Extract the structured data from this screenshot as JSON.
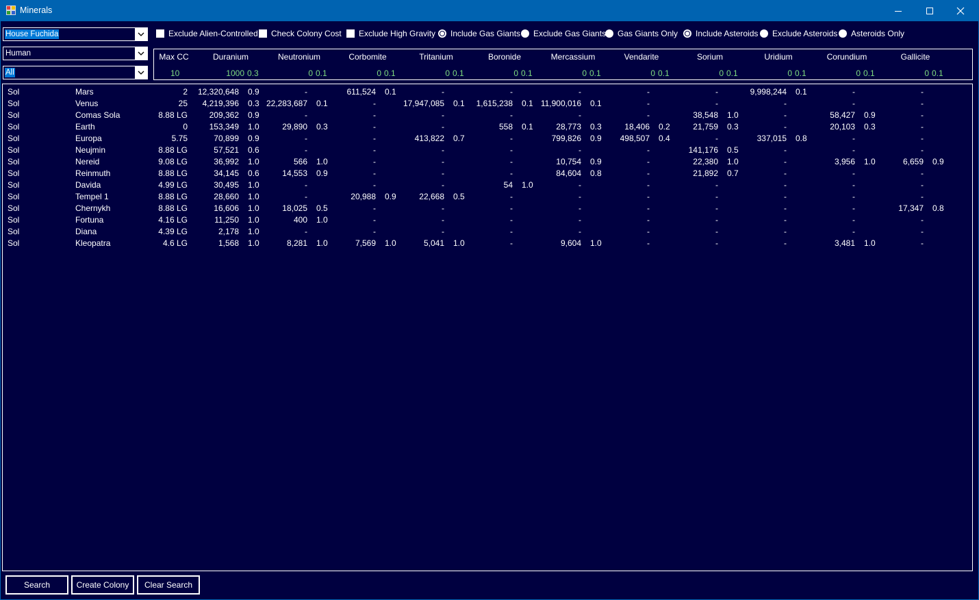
{
  "window": {
    "title": "Minerals"
  },
  "filters": {
    "race": "House Fuchida",
    "species": "Human",
    "system": "All"
  },
  "options": [
    {
      "label": "Exclude Alien-Controlled",
      "type": "checkbox",
      "checked": false
    },
    {
      "label": "Check Colony Cost",
      "type": "checkbox",
      "checked": false
    },
    {
      "label": "Exclude High Gravity",
      "type": "checkbox",
      "checked": false
    },
    {
      "label": "Include Gas Giants",
      "type": "radio",
      "checked": true
    },
    {
      "label": "Exclude Gas Giants",
      "type": "radio",
      "checked": false
    },
    {
      "label": "Gas Giants Only",
      "type": "radio",
      "checked": false
    },
    {
      "label": "Include Asteroids",
      "type": "radio",
      "checked": true
    },
    {
      "label": "Exclude Asteroids",
      "type": "radio",
      "checked": false
    },
    {
      "label": "Asteroids Only",
      "type": "radio",
      "checked": false
    }
  ],
  "header": {
    "max_cc": {
      "label": "Max CC",
      "value": "10"
    },
    "minerals": [
      {
        "name": "Duranium",
        "amount": "1000",
        "access": "0.3"
      },
      {
        "name": "Neutronium",
        "amount": "0",
        "access": "0.1"
      },
      {
        "name": "Corbomite",
        "amount": "0",
        "access": "0.1"
      },
      {
        "name": "Tritanium",
        "amount": "0",
        "access": "0.1"
      },
      {
        "name": "Boronide",
        "amount": "0",
        "access": "0.1"
      },
      {
        "name": "Mercassium",
        "amount": "0",
        "access": "0.1"
      },
      {
        "name": "Vendarite",
        "amount": "0",
        "access": "0.1"
      },
      {
        "name": "Sorium",
        "amount": "0",
        "access": "0.1"
      },
      {
        "name": "Uridium",
        "amount": "0",
        "access": "0.1"
      },
      {
        "name": "Corundium",
        "amount": "0",
        "access": "0.1"
      },
      {
        "name": "Gallicite",
        "amount": "0",
        "access": "0.1"
      }
    ]
  },
  "rows": [
    {
      "system": "Sol",
      "body": "Mars",
      "cc": "2",
      "m": [
        [
          "12,320,648",
          "0.9"
        ],
        [
          "-",
          ""
        ],
        [
          "611,524",
          "0.1"
        ],
        [
          "-",
          ""
        ],
        [
          "-",
          ""
        ],
        [
          "-",
          ""
        ],
        [
          "-",
          ""
        ],
        [
          "-",
          ""
        ],
        [
          "9,998,244",
          "0.1"
        ],
        [
          "-",
          ""
        ],
        [
          "-",
          ""
        ]
      ]
    },
    {
      "system": "Sol",
      "body": "Venus",
      "cc": "25",
      "m": [
        [
          "4,219,396",
          "0.3"
        ],
        [
          "22,283,687",
          "0.1"
        ],
        [
          "-",
          ""
        ],
        [
          "17,947,085",
          "0.1"
        ],
        [
          "1,615,238",
          "0.1"
        ],
        [
          "11,900,016",
          "0.1"
        ],
        [
          "-",
          ""
        ],
        [
          "-",
          ""
        ],
        [
          "-",
          ""
        ],
        [
          "-",
          ""
        ],
        [
          "-",
          ""
        ]
      ]
    },
    {
      "system": "Sol",
      "body": "Comas Sola",
      "cc": "8.88 LG",
      "m": [
        [
          "209,362",
          "0.9"
        ],
        [
          "-",
          ""
        ],
        [
          "-",
          ""
        ],
        [
          "-",
          ""
        ],
        [
          "-",
          ""
        ],
        [
          "-",
          ""
        ],
        [
          "-",
          ""
        ],
        [
          "38,548",
          "1.0"
        ],
        [
          "-",
          ""
        ],
        [
          "58,427",
          "0.9"
        ],
        [
          "-",
          ""
        ]
      ]
    },
    {
      "system": "Sol",
      "body": "Earth",
      "cc": "0",
      "m": [
        [
          "153,349",
          "1.0"
        ],
        [
          "29,890",
          "0.3"
        ],
        [
          "-",
          ""
        ],
        [
          "-",
          ""
        ],
        [
          "558",
          "0.1"
        ],
        [
          "28,773",
          "0.3"
        ],
        [
          "18,406",
          "0.2"
        ],
        [
          "21,759",
          "0.3"
        ],
        [
          "-",
          ""
        ],
        [
          "20,103",
          "0.3"
        ],
        [
          "-",
          ""
        ]
      ]
    },
    {
      "system": "Sol",
      "body": "Europa",
      "cc": "5.75",
      "m": [
        [
          "70,899",
          "0.9"
        ],
        [
          "-",
          ""
        ],
        [
          "-",
          ""
        ],
        [
          "413,822",
          "0.7"
        ],
        [
          "-",
          ""
        ],
        [
          "799,826",
          "0.9"
        ],
        [
          "498,507",
          "0.4"
        ],
        [
          "-",
          ""
        ],
        [
          "337,015",
          "0.8"
        ],
        [
          "-",
          ""
        ],
        [
          "-",
          ""
        ]
      ]
    },
    {
      "system": "Sol",
      "body": "Neujmin",
      "cc": "8.88 LG",
      "m": [
        [
          "57,521",
          "0.6"
        ],
        [
          "-",
          ""
        ],
        [
          "-",
          ""
        ],
        [
          "-",
          ""
        ],
        [
          "-",
          ""
        ],
        [
          "-",
          ""
        ],
        [
          "-",
          ""
        ],
        [
          "141,176",
          "0.5"
        ],
        [
          "-",
          ""
        ],
        [
          "-",
          ""
        ],
        [
          "-",
          ""
        ]
      ]
    },
    {
      "system": "Sol",
      "body": "Nereid",
      "cc": "9.08 LG",
      "m": [
        [
          "36,992",
          "1.0"
        ],
        [
          "566",
          "1.0"
        ],
        [
          "-",
          ""
        ],
        [
          "-",
          ""
        ],
        [
          "-",
          ""
        ],
        [
          "10,754",
          "0.9"
        ],
        [
          "-",
          ""
        ],
        [
          "22,380",
          "1.0"
        ],
        [
          "-",
          ""
        ],
        [
          "3,956",
          "1.0"
        ],
        [
          "6,659",
          "0.9"
        ]
      ]
    },
    {
      "system": "Sol",
      "body": "Reinmuth",
      "cc": "8.88 LG",
      "m": [
        [
          "34,145",
          "0.6"
        ],
        [
          "14,553",
          "0.9"
        ],
        [
          "-",
          ""
        ],
        [
          "-",
          ""
        ],
        [
          "-",
          ""
        ],
        [
          "84,604",
          "0.8"
        ],
        [
          "-",
          ""
        ],
        [
          "21,892",
          "0.7"
        ],
        [
          "-",
          ""
        ],
        [
          "-",
          ""
        ],
        [
          "-",
          ""
        ]
      ]
    },
    {
      "system": "Sol",
      "body": "Davida",
      "cc": "4.99 LG",
      "m": [
        [
          "30,495",
          "1.0"
        ],
        [
          "-",
          ""
        ],
        [
          "-",
          ""
        ],
        [
          "-",
          ""
        ],
        [
          "54",
          "1.0"
        ],
        [
          "-",
          ""
        ],
        [
          "-",
          ""
        ],
        [
          "-",
          ""
        ],
        [
          "-",
          ""
        ],
        [
          "-",
          ""
        ],
        [
          "-",
          ""
        ]
      ]
    },
    {
      "system": "Sol",
      "body": "Tempel 1",
      "cc": "8.88 LG",
      "m": [
        [
          "28,660",
          "1.0"
        ],
        [
          "-",
          ""
        ],
        [
          "20,988",
          "0.9"
        ],
        [
          "22,668",
          "0.5"
        ],
        [
          "-",
          ""
        ],
        [
          "-",
          ""
        ],
        [
          "-",
          ""
        ],
        [
          "-",
          ""
        ],
        [
          "-",
          ""
        ],
        [
          "-",
          ""
        ],
        [
          "-",
          ""
        ]
      ]
    },
    {
      "system": "Sol",
      "body": "Chernykh",
      "cc": "8.88 LG",
      "m": [
        [
          "16,606",
          "1.0"
        ],
        [
          "18,025",
          "0.5"
        ],
        [
          "-",
          ""
        ],
        [
          "-",
          ""
        ],
        [
          "-",
          ""
        ],
        [
          "-",
          ""
        ],
        [
          "-",
          ""
        ],
        [
          "-",
          ""
        ],
        [
          "-",
          ""
        ],
        [
          "-",
          ""
        ],
        [
          "17,347",
          "0.8"
        ]
      ]
    },
    {
      "system": "Sol",
      "body": "Fortuna",
      "cc": "4.16 LG",
      "m": [
        [
          "11,250",
          "1.0"
        ],
        [
          "400",
          "1.0"
        ],
        [
          "-",
          ""
        ],
        [
          "-",
          ""
        ],
        [
          "-",
          ""
        ],
        [
          "-",
          ""
        ],
        [
          "-",
          ""
        ],
        [
          "-",
          ""
        ],
        [
          "-",
          ""
        ],
        [
          "-",
          ""
        ],
        [
          "-",
          ""
        ]
      ]
    },
    {
      "system": "Sol",
      "body": "Diana",
      "cc": "4.39 LG",
      "m": [
        [
          "2,178",
          "1.0"
        ],
        [
          "-",
          ""
        ],
        [
          "-",
          ""
        ],
        [
          "-",
          ""
        ],
        [
          "-",
          ""
        ],
        [
          "-",
          ""
        ],
        [
          "-",
          ""
        ],
        [
          "-",
          ""
        ],
        [
          "-",
          ""
        ],
        [
          "-",
          ""
        ],
        [
          "-",
          ""
        ]
      ]
    },
    {
      "system": "Sol",
      "body": "Kleopatra",
      "cc": "4.6 LG",
      "m": [
        [
          "1,568",
          "1.0"
        ],
        [
          "8,281",
          "1.0"
        ],
        [
          "7,569",
          "1.0"
        ],
        [
          "5,041",
          "1.0"
        ],
        [
          "-",
          ""
        ],
        [
          "9,604",
          "1.0"
        ],
        [
          "-",
          ""
        ],
        [
          "-",
          ""
        ],
        [
          "-",
          ""
        ],
        [
          "3,481",
          "1.0"
        ],
        [
          "-",
          ""
        ]
      ]
    }
  ],
  "buttons": {
    "search": "Search",
    "create_colony": "Create Colony",
    "clear_search": "Clear Search"
  },
  "icons": {
    "app": "minerals-app-icon",
    "minimize": "minimize-icon",
    "maximize": "maximize-icon",
    "close": "close-icon",
    "dropdown": "chevron-down-icon"
  },
  "colors": {
    "background": "#000040",
    "titlebar": "#0063b1",
    "header_values": "#7fdc7f",
    "selection": "#0078d7"
  }
}
